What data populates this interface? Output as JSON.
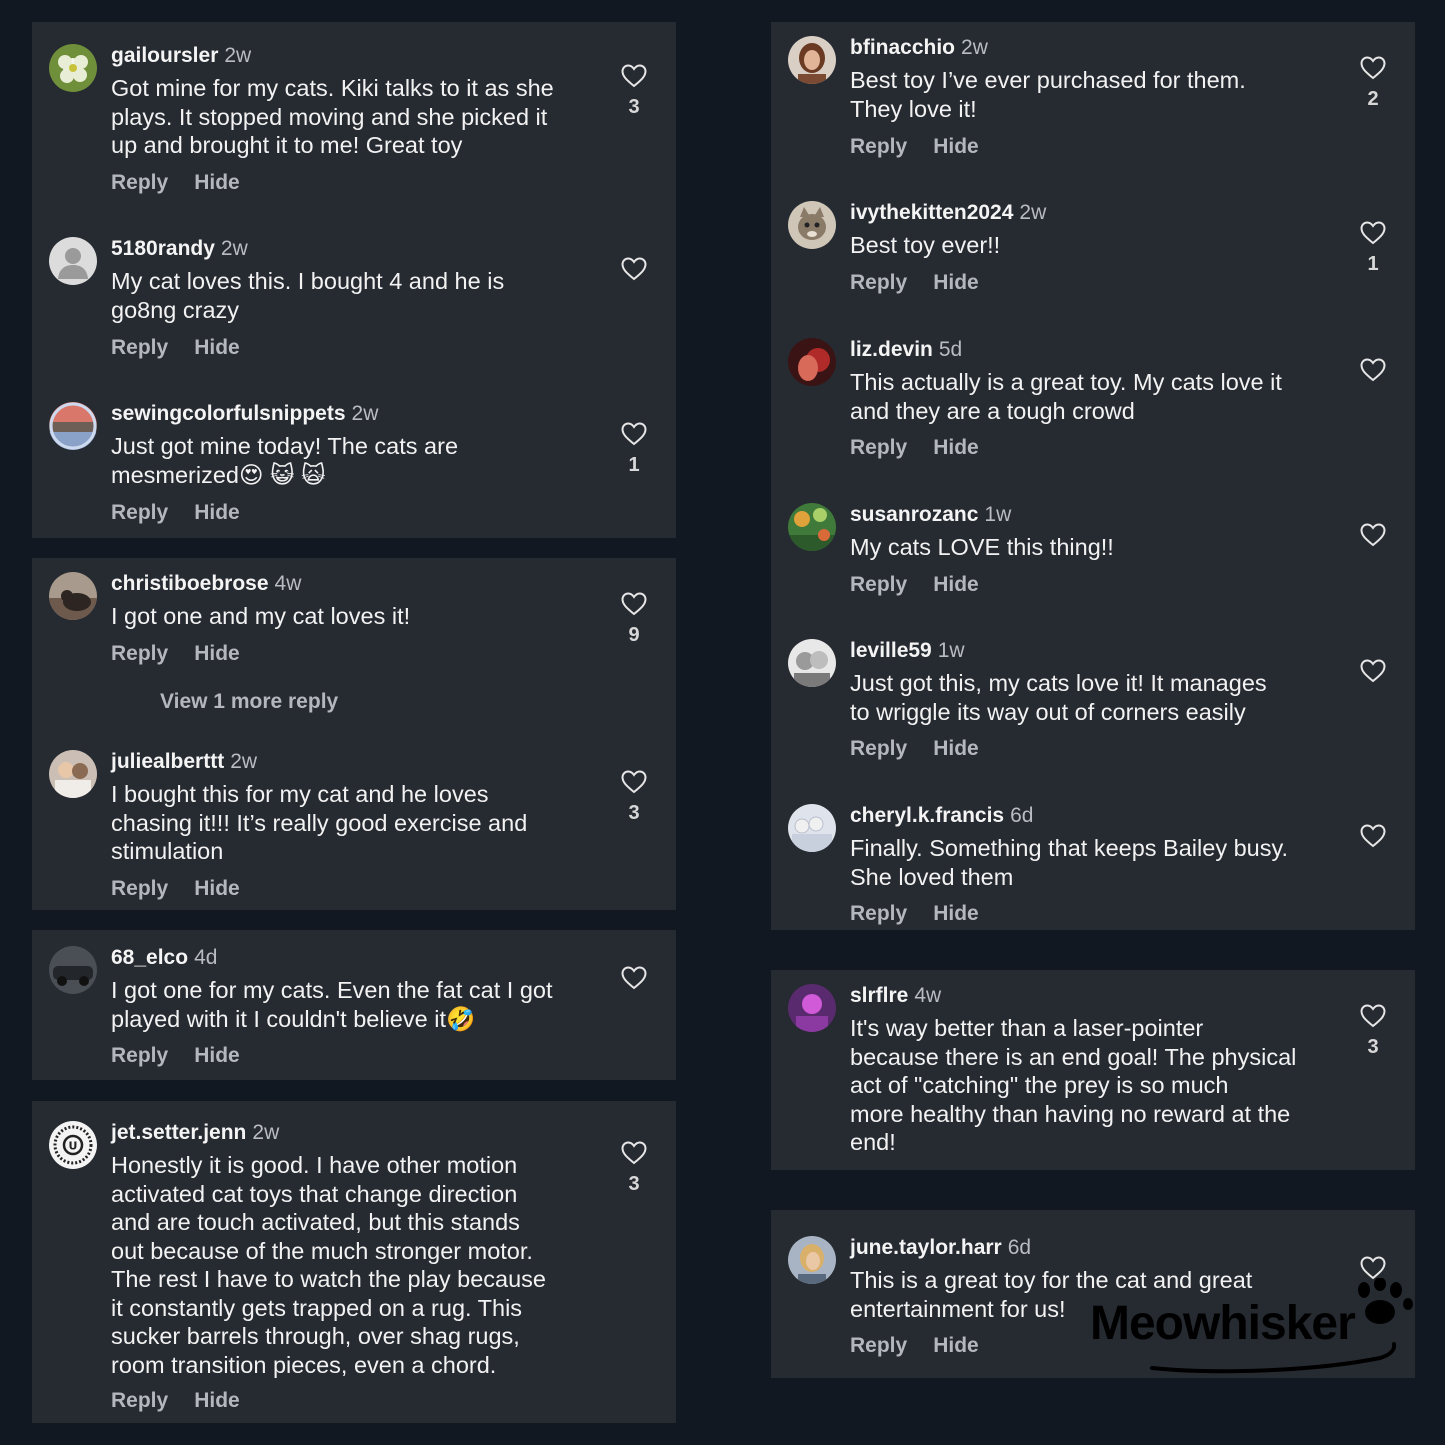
{
  "left_column": [
    {
      "comments": [
        {
          "username": "gailoursler",
          "age": "2w",
          "lines": [
            "Got mine for my cats. Kiki talks to it as she",
            "plays. It stopped moving and she picked it",
            "up and brought it to me! Great toy"
          ],
          "likes": "3",
          "reply": "Reply",
          "hide": "Hide",
          "avatar": "flower-avatar"
        },
        {
          "username": "5180randy",
          "age": "2w",
          "lines": [
            "My cat loves this. I bought 4 and he is",
            "go8ng crazy"
          ],
          "likes": "",
          "reply": "Reply",
          "hide": "Hide",
          "avatar": "default-avatar"
        },
        {
          "username": "sewingcolorfulsnippets",
          "age": "2w",
          "lines": [
            "Just got mine today! The cats are",
            "mesmerized😍 😺 🙀"
          ],
          "likes": "1",
          "reply": "Reply",
          "hide": "Hide",
          "avatar": "sunset-avatar"
        }
      ]
    },
    {
      "comments": [
        {
          "username": "christiboebrose",
          "age": "4w",
          "lines": [
            "I got one and my cat loves it!"
          ],
          "likes": "9",
          "reply": "Reply",
          "hide": "Hide",
          "avatar": "cat-photo-avatar"
        },
        {
          "username": "juliealberttt",
          "age": "2w",
          "lines": [
            "I bought this for my cat and he loves",
            "chasing it!!! It’s really good exercise and",
            "stimulation"
          ],
          "likes": "3",
          "reply": "Reply",
          "hide": "Hide",
          "avatar": "people-avatar"
        }
      ],
      "view_more": "View 1 more reply"
    },
    {
      "comments": [
        {
          "username": "68_elco",
          "age": "4d",
          "lines": [
            "I got one for my cats. Even the fat cat I got",
            "played with it I couldn't believe it🤣"
          ],
          "likes": "",
          "reply": "Reply",
          "hide": "Hide",
          "avatar": "car-avatar"
        }
      ]
    },
    {
      "comments": [
        {
          "username": "jet.setter.jenn",
          "age": "2w",
          "lines": [
            "Honestly it is good. I have other motion",
            "activated cat toys that change direction",
            "and are touch activated, but this stands",
            "out because of the much stronger motor.",
            "The rest I have to watch the play because",
            "it constantly gets trapped on a rug. This",
            "sucker barrels through, over shag rugs,",
            "room transition pieces, even a chord."
          ],
          "likes": "3",
          "reply": "Reply",
          "hide": "Hide",
          "avatar": "emblem-avatar"
        }
      ]
    }
  ],
  "right_column": [
    {
      "comments": [
        {
          "username": "bfinacchio",
          "age": "2w",
          "lines": [
            "Best toy I’ve ever purchased for them.",
            "They love it!"
          ],
          "likes": "2",
          "reply": "Reply",
          "hide": "Hide",
          "avatar": "portrait-avatar"
        },
        {
          "username": "ivythekitten2024",
          "age": "2w",
          "lines": [
            "Best toy ever!!"
          ],
          "likes": "1",
          "reply": "Reply",
          "hide": "Hide",
          "avatar": "kitten-avatar"
        },
        {
          "username": "liz.devin",
          "age": "5d",
          "lines": [
            "This actually is a great toy. My cats love it",
            "and they are a tough crowd"
          ],
          "likes": "",
          "reply": "Reply",
          "hide": "Hide",
          "avatar": "red-avatar"
        },
        {
          "username": "susanrozanc",
          "age": "1w",
          "lines": [
            "My cats LOVE this thing!!"
          ],
          "likes": "",
          "reply": "Reply",
          "hide": "Hide",
          "avatar": "garden-avatar"
        },
        {
          "username": "leville59",
          "age": "1w",
          "lines": [
            "Just got this, my cats love it! It manages",
            "to wriggle its way out of corners easily"
          ],
          "likes": "",
          "reply": "Reply",
          "hide": "Hide",
          "avatar": "couple-avatar"
        },
        {
          "username": "cheryl.k.francis",
          "age": "6d",
          "lines": [
            "Finally. Something that keeps Bailey busy.",
            "She loved them"
          ],
          "likes": "",
          "reply": "Reply",
          "hide": "Hide",
          "avatar": "group-avatar"
        }
      ]
    },
    {
      "comments": [
        {
          "username": "slrflre",
          "age": "4w",
          "lines": [
            "It's way better than a laser-pointer",
            "because there is an end goal! The physical",
            "act of \"catching\" the prey is so much",
            "more healthy than having no reward at the",
            "end!"
          ],
          "likes": "3",
          "reply": "",
          "hide": "",
          "avatar": "purple-avatar"
        }
      ]
    },
    {
      "comments": [
        {
          "username": "june.taylor.harr",
          "age": "6d",
          "lines": [
            "This is a great toy for the cat and great",
            "entertainment for us!"
          ],
          "likes": "",
          "reply": "Reply",
          "hide": "Hide",
          "avatar": "selfie-avatar"
        }
      ]
    }
  ],
  "brand": {
    "name": "Meowhisker"
  },
  "colors": {
    "background": "#121822",
    "card": "#262a31",
    "text": "#f2f2f2",
    "muted": "#b4b7bd"
  }
}
